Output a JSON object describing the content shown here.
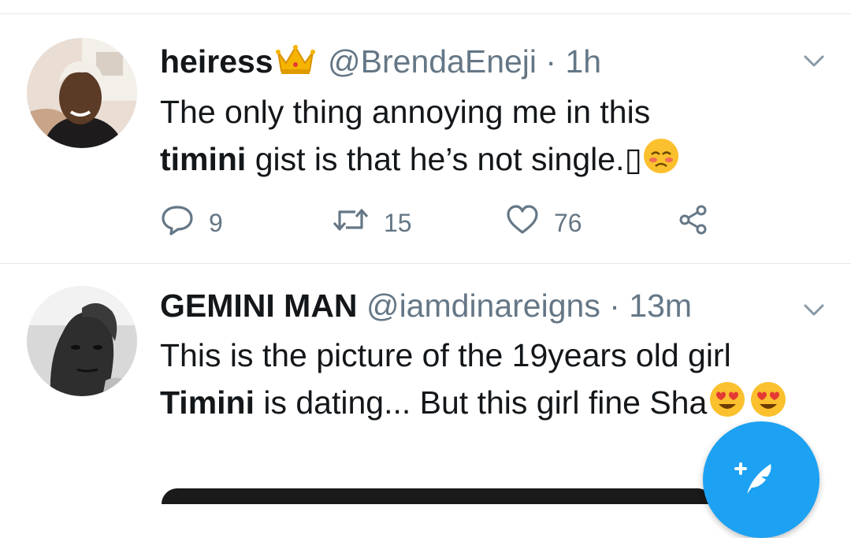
{
  "colors": {
    "accent": "#1da1f2",
    "text": "#14171a",
    "secondary": "#657786",
    "divider": "#e1e8ed"
  },
  "tweets": [
    {
      "display_name": "heiress",
      "name_emoji": "crown-emoji",
      "handle": "@BrendaEneji",
      "dot": "·",
      "time": "1h",
      "text_part1": "The only thing annoying me in this",
      "mention": "timini",
      "text_part2": " gist is that he’s not single.",
      "trailing_glyph": "▯",
      "trailing_emoji": "flushed-face-emoji",
      "reply_count": "9",
      "retweet_count": "15",
      "like_count": "76"
    },
    {
      "display_name": "GEMINI MAN",
      "handle": "@iamdinareigns",
      "dot": "·",
      "time": "13m",
      "text_part1": "This is the picture of the 19years old girl ",
      "mention": "Timini",
      "text_part2": " is dating... But this girl fine Sha",
      "trailing_emojis": [
        "heart-eyes-emoji",
        "heart-eyes-emoji"
      ]
    }
  ],
  "compose_button": {
    "icon": "compose-feather-icon"
  }
}
